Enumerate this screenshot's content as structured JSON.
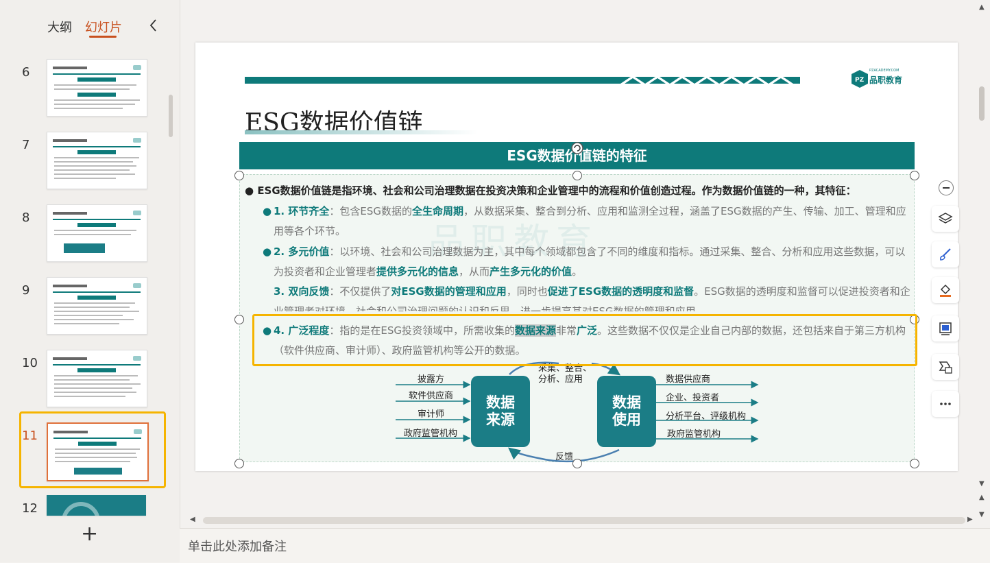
{
  "left_panel": {
    "tabs": {
      "outline": "大纲",
      "slides": "幻灯片"
    },
    "slide_numbers": [
      "6",
      "7",
      "8",
      "9",
      "10",
      "11",
      "12"
    ],
    "active_slide": "11",
    "add_symbol": "+"
  },
  "slide": {
    "title": "ESG数据价值链",
    "brand": "品职教育",
    "brand_sub": "PZACADEMY.COM",
    "section_header": "ESG数据价值链的特征",
    "watermark": "品职教育",
    "intro": "ESG数据价值链是指环境、社会和公司治理数据在投资决策和企业管理中的流程和价值创造过程。作为数据价值链的一种，其特征：",
    "features": [
      {
        "label": "1. 环节齐全",
        "p1": "：包含ESG数据的",
        "b1": "全生命周期",
        "p2": "，从数据采集、整合到分析、应用和监测全过程，涵盖了ESG数据的产生、传输、加工、管理和应用等各个环节。"
      },
      {
        "label": "2. 多元价值",
        "p1": "：以环境、社会和公司治理数据为主，其中每个领域都包含了不同的维度和指标。通过采集、整合、分析和应用这些数据，可以为投资者和企业管理者",
        "b1": "提供多元化的信息",
        "p2": "，从而",
        "b2": "产生多元化的价值",
        "p3": "。"
      },
      {
        "label": "3. 双向反馈",
        "p1": "：不仅提供了",
        "b1": "对ESG数据的管理和应用",
        "p2": "，同时也",
        "b2": "促进了ESG数据的透明度和监督",
        "p3": "。ESG数据的透明度和监督可以促进投资者和企业管理者对环境、社会和公司治理问题的认识和反思，进一步提高其对ESG数据的管理和应用。"
      },
      {
        "label": "4. 广泛程度",
        "p1": "：指的是在ESG投资领域中，所需收集的",
        "hl": "数据来源",
        "p2": "非常",
        "b1": "广泛",
        "p3": "。这些数据不仅仅是企业自己内部的数据，还包括来自于第三方机构（软件供应商、审计师）、政府监管机构等公开的数据。"
      }
    ],
    "diagram": {
      "sources": [
        "披露方",
        "软件供应商",
        "审计师",
        "政府监管机构"
      ],
      "source_box": "数据来源",
      "use_box": "数据使用",
      "uses": [
        "数据供应商",
        "企业、投资者",
        "分析平台、评级机构",
        "政府监管机构"
      ],
      "top_arc_label_1": "采集、整合、",
      "top_arc_label_2": "分析、应用",
      "bottom_arc_label": "反馈"
    }
  },
  "notes_placeholder": "单击此处添加备注",
  "colors": {
    "accent": "#0e7a7a",
    "highlight": "#f5b400",
    "active_tab": "#c8501e"
  }
}
